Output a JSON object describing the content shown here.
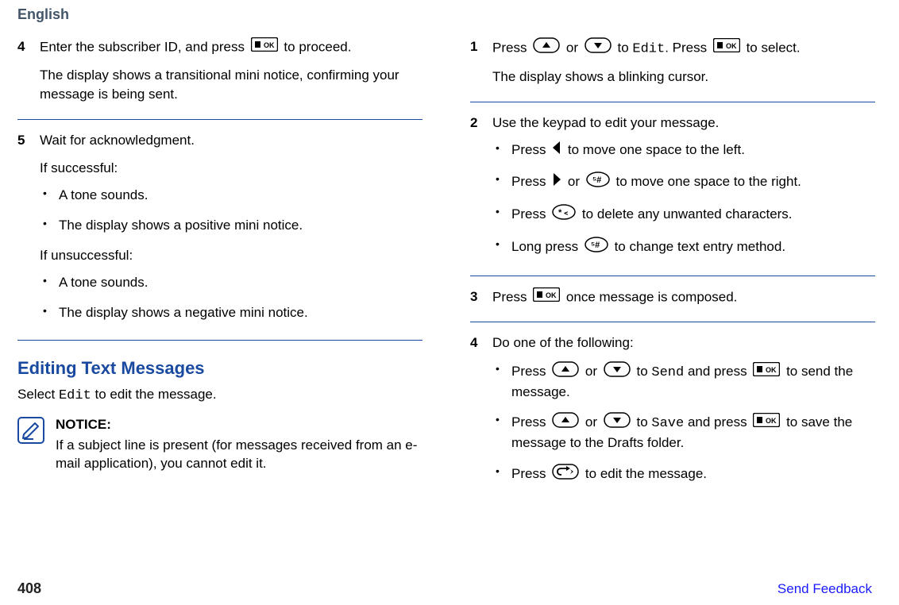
{
  "header": {
    "language": "English"
  },
  "left": {
    "step4": {
      "num": "4",
      "line1_a": "Enter the subscriber ID, and press ",
      "line1_b": " to proceed.",
      "line2": "The display shows a transitional mini notice, confirming your message is being sent."
    },
    "step5": {
      "num": "5",
      "line1": "Wait for acknowledgment.",
      "if_success": "If successful:",
      "s_bullet1": "A tone sounds.",
      "s_bullet2": "The display shows a positive mini notice.",
      "if_fail": "If unsuccessful:",
      "f_bullet1": "A tone sounds.",
      "f_bullet2": "The display shows a negative mini notice."
    },
    "heading": "Editing Text Messages",
    "intro_a": "Select ",
    "intro_edit": "Edit",
    "intro_b": " to edit the message.",
    "notice_title": "NOTICE:",
    "notice_body": "If a subject line is present (for messages received from an e-mail application), you cannot edit it."
  },
  "right": {
    "step1": {
      "num": "1",
      "a": "Press ",
      "or": " or ",
      "to": " to ",
      "edit": "Edit",
      "press": ". Press ",
      "sel": " to select.",
      "line2": "The display shows a blinking cursor."
    },
    "step2": {
      "num": "2",
      "line1": "Use the keypad to edit your message.",
      "b1_a": "Press ",
      "b1_b": " to move one space to the left.",
      "b2_a": "Press ",
      "b2_or": " or ",
      "b2_b": " to move one space to the right.",
      "b3_a": "Press ",
      "b3_b": " to delete any unwanted characters.",
      "b4_a": "Long press ",
      "b4_b": " to change text entry method."
    },
    "step3": {
      "num": "3",
      "a": "Press ",
      "b": " once message is composed."
    },
    "step4": {
      "num": "4",
      "line1": "Do one of the following:",
      "b1_a": "Press ",
      "or": " or ",
      "b1_to": " to ",
      "send": "Send",
      "b1_press": " and press ",
      "b1_end": " to send the message.",
      "b2_to": " to ",
      "save": "Save",
      "b2_press": " and press ",
      "b2_end": " to save the message to the Drafts folder.",
      "b3_a": "Press ",
      "b3_b": " to edit the message."
    }
  },
  "footer": {
    "page": "408",
    "feedback": "Send Feedback"
  }
}
